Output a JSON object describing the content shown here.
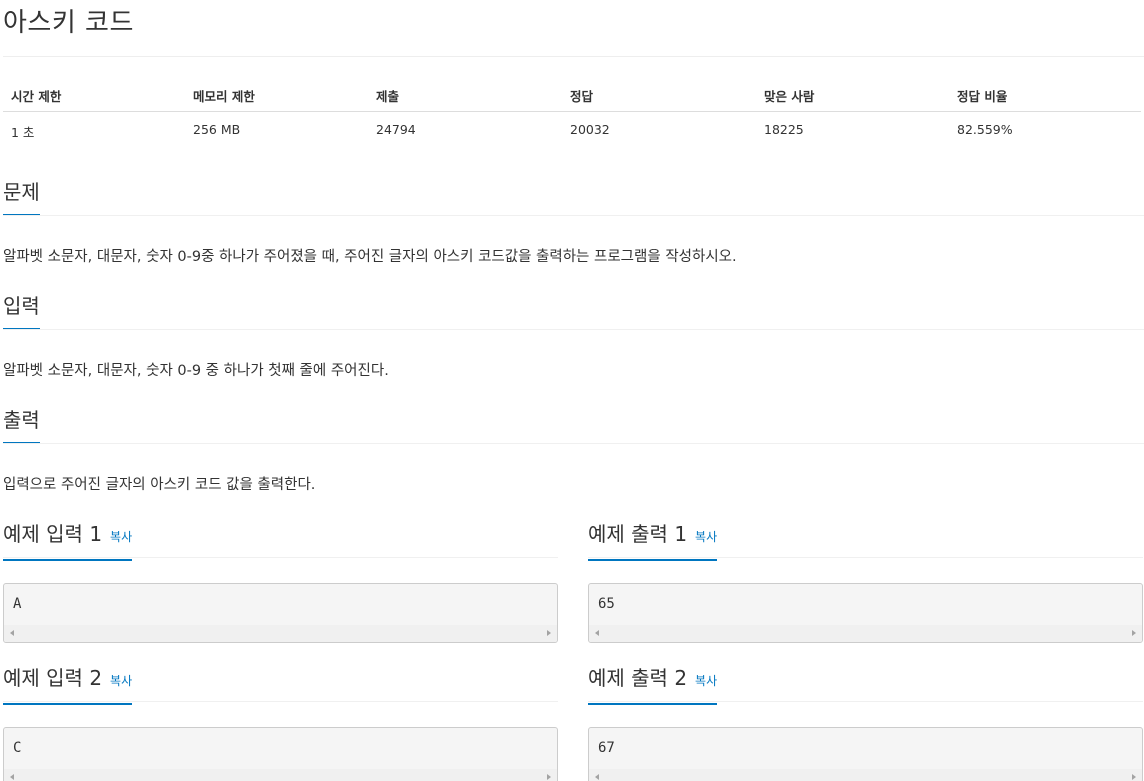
{
  "problem": {
    "title": "아스키 코드"
  },
  "info": {
    "headers": [
      "시간 제한",
      "메모리 제한",
      "제출",
      "정답",
      "맞은 사람",
      "정답 비율"
    ],
    "values": [
      "1 초",
      "256 MB",
      "24794",
      "20032",
      "18225",
      "82.559%"
    ]
  },
  "sections": {
    "description": {
      "title": "문제",
      "text": "알파벳 소문자, 대문자, 숫자 0-9중 하나가 주어졌을 때, 주어진 글자의 아스키 코드값을 출력하는 프로그램을 작성하시오."
    },
    "input": {
      "title": "입력",
      "text": "알파벳 소문자, 대문자, 숫자 0-9 중 하나가 첫째 줄에 주어진다."
    },
    "output": {
      "title": "출력",
      "text": "입력으로 주어진 글자의 아스키 코드 값을 출력한다."
    }
  },
  "samples": {
    "copy_label": "복사",
    "input1": {
      "title": "예제 입력 1",
      "value": "A"
    },
    "output1": {
      "title": "예제 출력 1",
      "value": "65"
    },
    "input2": {
      "title": "예제 입력 2",
      "value": "C"
    },
    "output2": {
      "title": "예제 출력 2",
      "value": "67"
    }
  },
  "colors": {
    "accent": "#0076c0",
    "text": "#333333",
    "pre_background": "#f5f5f5"
  },
  "icons": {
    "scroll_left": "scroll-left-arrow-icon",
    "scroll_right": "scroll-right-arrow-icon"
  }
}
